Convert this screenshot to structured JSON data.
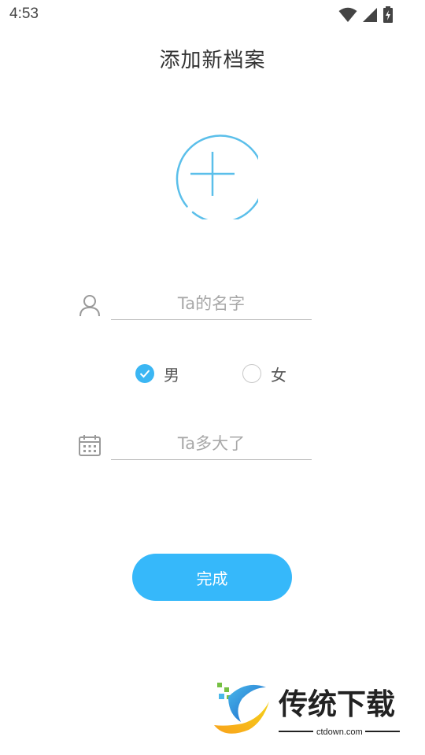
{
  "status_bar": {
    "time": "4:53",
    "icons": [
      "wifi-icon",
      "signal-icon",
      "battery-charging-icon"
    ]
  },
  "header": {
    "title": "添加新档案"
  },
  "avatar": {
    "icon": "plus-icon",
    "accent_color": "#5bbfea"
  },
  "form": {
    "name": {
      "icon": "person-icon",
      "placeholder": "Ta的名字"
    },
    "gender": {
      "selected": "男",
      "options": [
        {
          "label": "男",
          "checked": true
        },
        {
          "label": "女",
          "checked": false
        }
      ]
    },
    "age": {
      "icon": "calendar-icon",
      "placeholder": "Ta多大了"
    }
  },
  "actions": {
    "done_label": "完成",
    "button_color": "#36b8fa"
  },
  "watermark": {
    "brand": "传统下载",
    "domain": "ctdown.com"
  }
}
